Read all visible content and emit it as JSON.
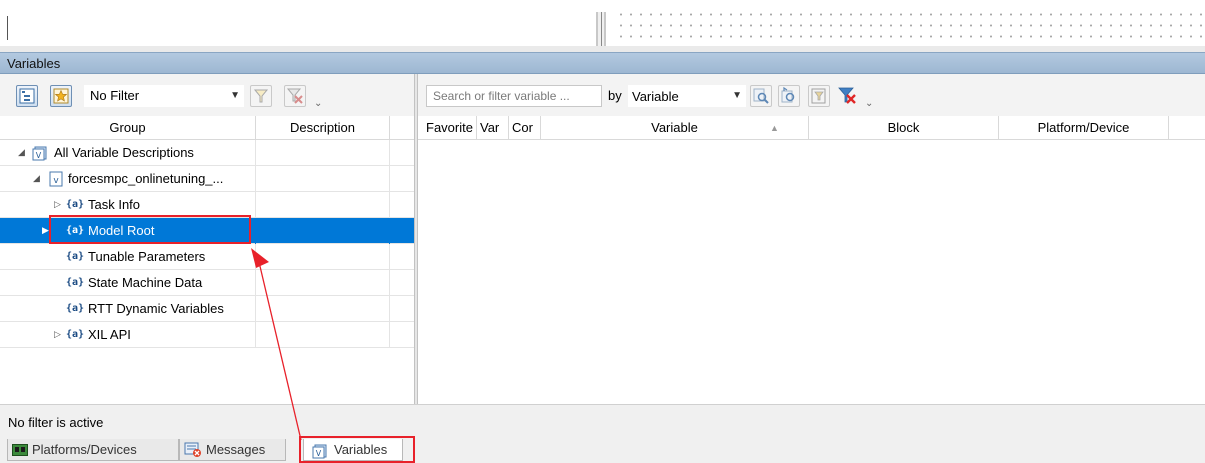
{
  "panel": {
    "title": "Variables"
  },
  "left_toolbar": {
    "filter_value": "No Filter",
    "filter_options_visible": [
      "No Filter"
    ]
  },
  "tree": {
    "columns": [
      "Group",
      "Description"
    ],
    "rows": [
      {
        "label": "All Variable Descriptions",
        "icon": "variables-icon",
        "expander": "expanded",
        "level": 0
      },
      {
        "label": "forcesmpc_onlinetuning_...",
        "icon": "variable-file-icon",
        "expander": "expanded",
        "level": 1
      },
      {
        "label": "Task Info",
        "icon": "braces-icon",
        "expander": "collapsed",
        "level": 2
      },
      {
        "label": "Model Root",
        "icon": "braces-icon",
        "expander": "collapsed",
        "level": 2,
        "selected": true
      },
      {
        "label": "Tunable Parameters",
        "icon": "braces-icon",
        "expander": "none",
        "level": 2
      },
      {
        "label": "State Machine Data",
        "icon": "braces-icon",
        "expander": "none",
        "level": 2
      },
      {
        "label": "RTT Dynamic Variables",
        "icon": "braces-icon",
        "expander": "none",
        "level": 2
      },
      {
        "label": "XIL API",
        "icon": "braces-icon",
        "expander": "collapsed",
        "level": 2
      }
    ]
  },
  "right_toolbar": {
    "search_placeholder": "Search or filter variable ...",
    "by_label": "by",
    "by_value": "Variable"
  },
  "var_grid": {
    "columns": [
      "Favorite",
      "Var",
      "Cor",
      "Variable",
      "Block",
      "Platform/Device"
    ],
    "sorted_column": "Variable",
    "sort_direction": "ascending"
  },
  "status": {
    "text": "No filter is active"
  },
  "tabs": [
    {
      "label": "Platforms/Devices",
      "icon": "platforms-icon"
    },
    {
      "label": "Messages",
      "icon": "messages-icon"
    },
    {
      "label": "Variables",
      "icon": "variables-icon",
      "active": true
    }
  ],
  "annotations": {
    "color": "#e8212a"
  },
  "colors": {
    "selection": "#0078d7",
    "panel_title": "#a9c1da"
  }
}
